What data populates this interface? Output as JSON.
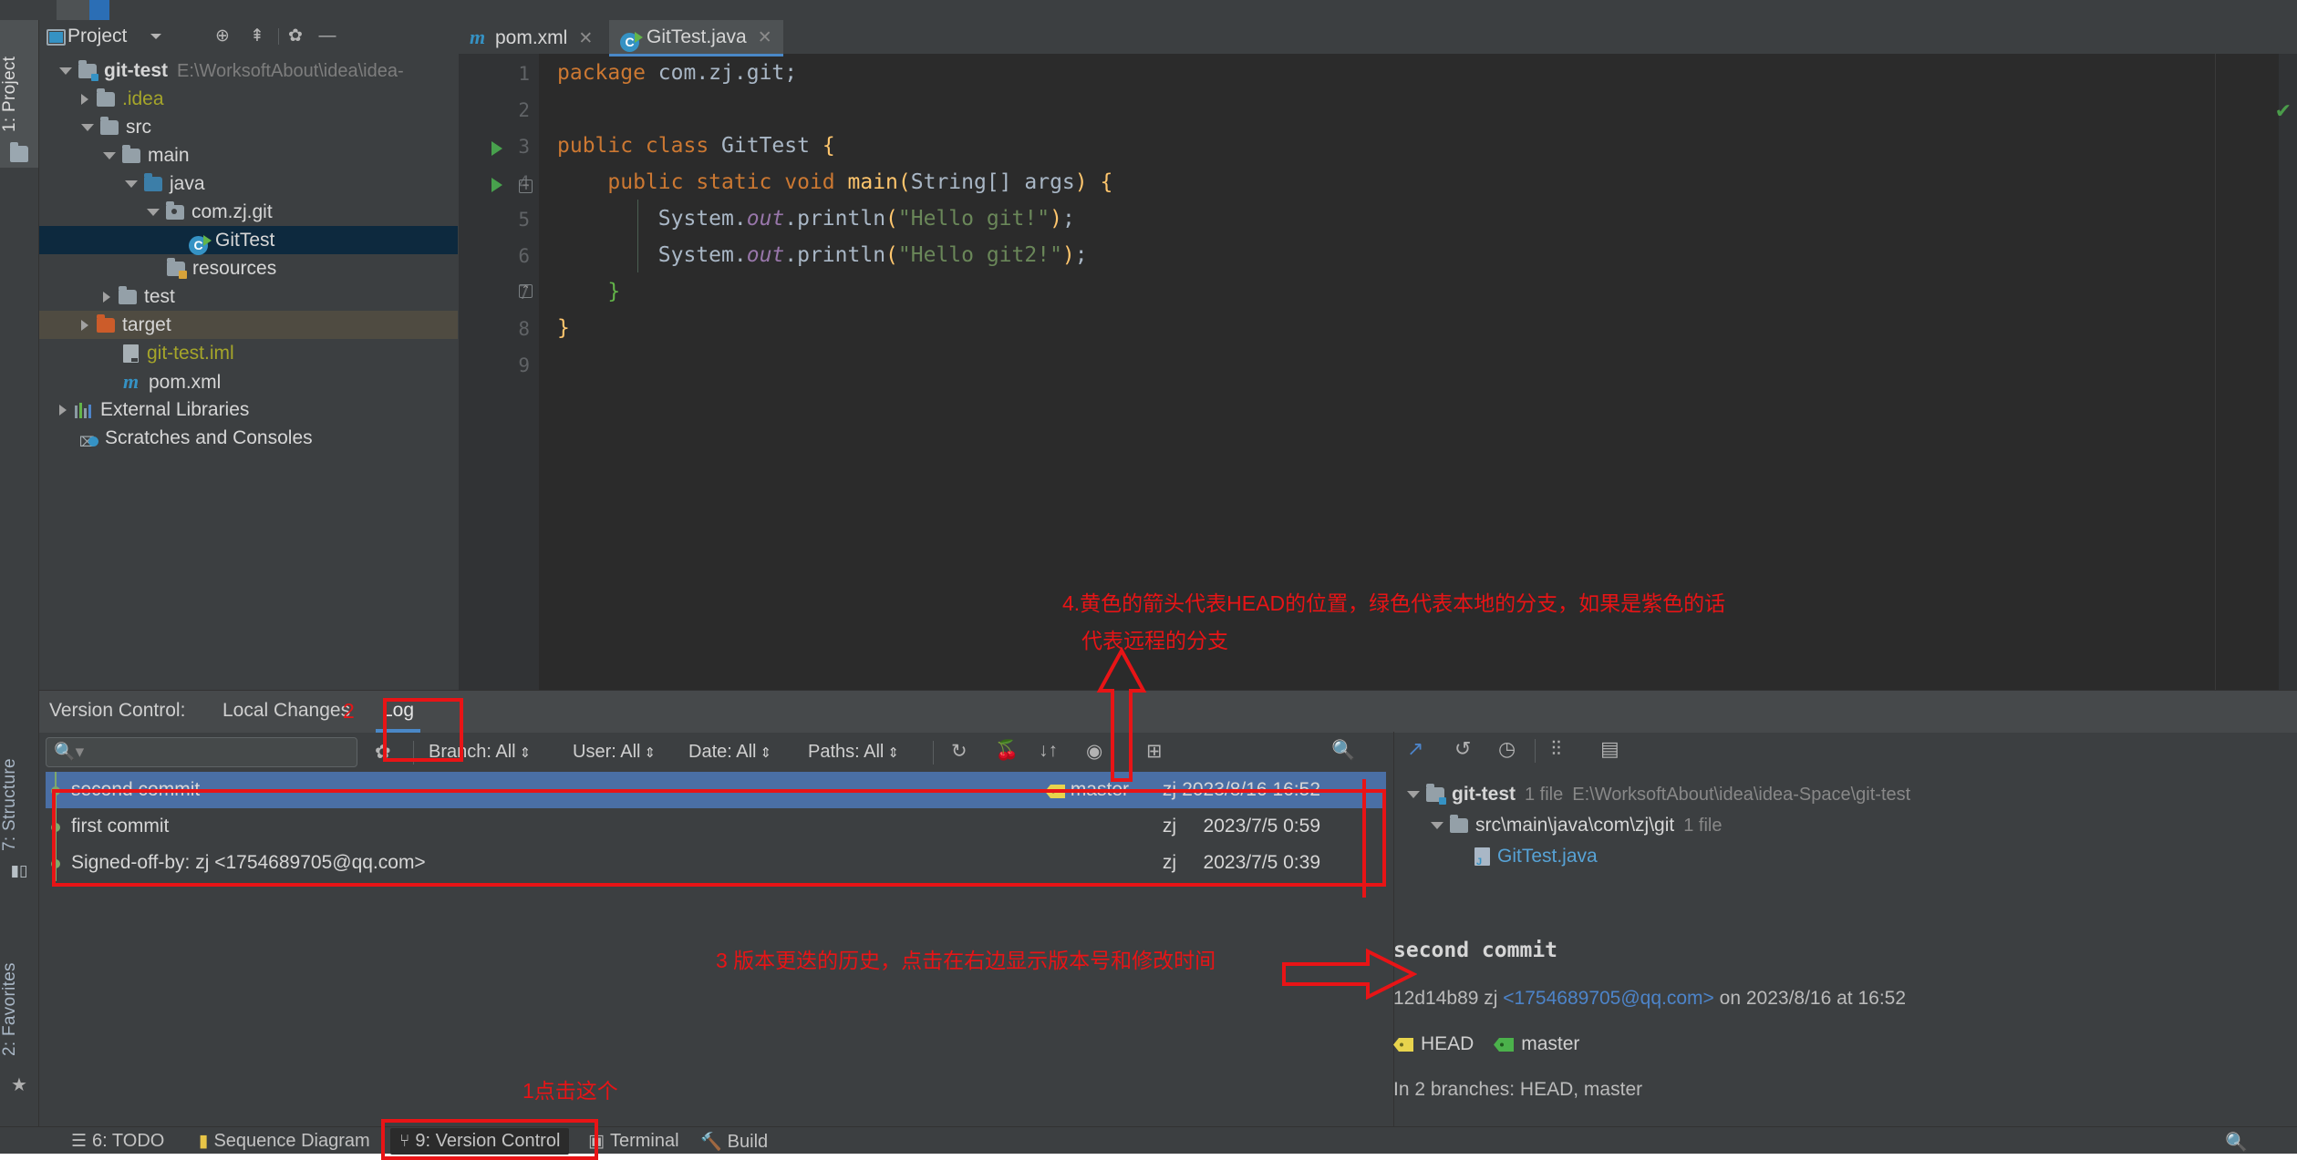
{
  "app": {
    "project_panel_title": "Project",
    "left_tabs": [
      {
        "label": "1: Project",
        "selected": true
      },
      {
        "label": "7: Structure",
        "selected": false
      },
      {
        "label": "2: Favorites",
        "selected": false
      }
    ]
  },
  "project_tree": [
    {
      "label": "git-test",
      "detail": "E:\\WorksoftAbout\\idea\\idea-",
      "indent": 0,
      "arrow": "down",
      "icon": "module-folder-icon",
      "bold": true,
      "state": "normal"
    },
    {
      "label": ".idea",
      "detail": "",
      "indent": 1,
      "arrow": "right",
      "icon": "folder-gray-icon",
      "bold": false,
      "state": "olive"
    },
    {
      "label": "src",
      "detail": "",
      "indent": 1,
      "arrow": "down",
      "icon": "folder-gray-icon",
      "bold": false,
      "state": "normal"
    },
    {
      "label": "main",
      "detail": "",
      "indent": 2,
      "arrow": "down",
      "icon": "folder-gray-icon",
      "bold": false,
      "state": "normal"
    },
    {
      "label": "java",
      "detail": "",
      "indent": 3,
      "arrow": "down",
      "icon": "folder-source-icon",
      "bold": false,
      "state": "normal"
    },
    {
      "label": "com.zj.git",
      "detail": "",
      "indent": 4,
      "arrow": "down",
      "icon": "package-icon",
      "bold": false,
      "state": "normal"
    },
    {
      "label": "GitTest",
      "detail": "",
      "indent": 5,
      "arrow": "none",
      "icon": "java-class-icon",
      "bold": false,
      "state": "selected"
    },
    {
      "label": "resources",
      "detail": "",
      "indent": 4,
      "arrow": "none",
      "icon": "folder-resources-icon",
      "bold": false,
      "state": "normal"
    },
    {
      "label": "test",
      "detail": "",
      "indent": 2,
      "arrow": "right",
      "icon": "folder-gray-icon",
      "bold": false,
      "state": "normal"
    },
    {
      "label": "target",
      "detail": "",
      "indent": 1,
      "arrow": "right",
      "icon": "folder-excluded-icon",
      "bold": false,
      "state": "highlight"
    },
    {
      "label": "git-test.iml",
      "detail": "",
      "indent": 2,
      "arrow": "none",
      "icon": "iml-file-icon",
      "bold": false,
      "state": "olive"
    },
    {
      "label": "pom.xml",
      "detail": "",
      "indent": 2,
      "arrow": "none",
      "icon": "maven-file-icon",
      "bold": false,
      "state": "normal"
    },
    {
      "label": "External Libraries",
      "detail": "",
      "indent": 0,
      "arrow": "right",
      "icon": "libraries-icon",
      "bold": false,
      "state": "normal"
    },
    {
      "label": "Scratches and Consoles",
      "detail": "",
      "indent": 0,
      "arrow": "none",
      "icon": "scratches-icon",
      "bold": false,
      "state": "normal"
    }
  ],
  "editor": {
    "tabs": [
      {
        "label": "pom.xml",
        "icon": "maven-icon",
        "active": false
      },
      {
        "label": "GitTest.java",
        "icon": "java-class-icon",
        "active": true
      }
    ],
    "line_numbers": [
      "1",
      "2",
      "3",
      "4",
      "5",
      "6",
      "7",
      "8",
      "9"
    ],
    "code_lines": [
      {
        "n": 1,
        "text": "package com.zj.git;"
      },
      {
        "n": 2,
        "text": ""
      },
      {
        "n": 3,
        "text": "public class GitTest {"
      },
      {
        "n": 4,
        "text": "    public static void main(String[] args) {"
      },
      {
        "n": 5,
        "text": "        System.out.println(\"Hello git!\");"
      },
      {
        "n": 6,
        "text": "        System.out.println(\"Hello git2!\");"
      },
      {
        "n": 7,
        "text": "    }"
      },
      {
        "n": 8,
        "text": "}"
      },
      {
        "n": 9,
        "text": ""
      }
    ]
  },
  "version_control": {
    "panel_label": "Version Control:",
    "tabs": [
      {
        "label": "Local Changes",
        "selected": false
      },
      {
        "label": "Log",
        "selected": true
      }
    ],
    "annotation_number": "2",
    "search_placeholder": "",
    "search_icon": "search-icon",
    "filters": [
      {
        "label": "Branch: All"
      },
      {
        "label": "User: All"
      },
      {
        "label": "Date: All"
      },
      {
        "label": "Paths: All"
      }
    ],
    "toolbar_icons": [
      "refresh-icon",
      "cherry-pick-icon",
      "sort-icon",
      "eye-icon",
      "show-details-icon"
    ],
    "search_magnifier": "search-icon",
    "commits": [
      {
        "message": "second commit",
        "tag": "master",
        "tag_color": "#e8d44d",
        "author": "zj",
        "date": "2023/8/16 16:52",
        "selected": true
      },
      {
        "message": "first commit",
        "tag": "",
        "tag_color": "",
        "author": "zj",
        "date": "2023/7/5 0:59",
        "selected": false
      },
      {
        "message": "Signed-off-by: zj <1754689705@qq.com>",
        "tag": "",
        "tag_color": "",
        "author": "zj",
        "date": "2023/7/5 0:39",
        "selected": false
      }
    ],
    "right_toolbar_icons": [
      "jump-to-source-icon",
      "revert-icon",
      "history-icon",
      "group-by-icon",
      "expand-icon"
    ],
    "changed_files": [
      {
        "label": "git-test",
        "count": "1 file",
        "path": "E:\\WorksoftAbout\\idea\\idea-Space\\git-test",
        "indent": 0,
        "arrow": "down",
        "icon": "module-folder-icon",
        "bold": true,
        "link": false
      },
      {
        "label": "src\\main\\java\\com\\zj\\git",
        "count": "1 file",
        "path": "",
        "indent": 1,
        "arrow": "down",
        "icon": "folder-gray-icon",
        "bold": false,
        "link": false
      },
      {
        "label": "GitTest.java",
        "count": "",
        "path": "",
        "indent": 2,
        "arrow": "none",
        "icon": "java-file-icon",
        "bold": false,
        "link": true
      }
    ],
    "commit_detail": {
      "title": "second commit",
      "hash": "12d14b89",
      "author": "zj",
      "email": "<1754689705@qq.com>",
      "on_text": "on 2023/8/16 at 16:52",
      "refs": [
        {
          "label": "HEAD",
          "color": "#e8d44d"
        },
        {
          "label": "master",
          "color": "#4bb14b"
        }
      ],
      "branches_text": "In 2 branches: HEAD, master"
    }
  },
  "status_bar": [
    {
      "label": "6: TODO",
      "icon": "todo-icon",
      "underline_index": 0,
      "selected": false
    },
    {
      "label": "Sequence Diagram",
      "icon": "sequence-diagram-icon",
      "underline_index": -1,
      "selected": false
    },
    {
      "label": "9: Version Control",
      "icon": "version-control-icon",
      "underline_index": 0,
      "selected": true
    },
    {
      "label": "Terminal",
      "icon": "terminal-icon",
      "underline_index": -1,
      "selected": false
    },
    {
      "label": "Build",
      "icon": "build-icon",
      "underline_index": -1,
      "selected": false
    }
  ],
  "annotations": [
    {
      "id": "ann-4",
      "line1": "4.黄色的箭头代表HEAD的位置，绿色代表本地的分支，如果是紫色的话",
      "line2": "代表远程的分支"
    },
    {
      "id": "ann-3",
      "text": "3 版本更迭的历史，点击在右边显示版本号和修改时间"
    },
    {
      "id": "ann-1",
      "text": "1点击这个"
    },
    {
      "id": "ann-2",
      "text": "2"
    }
  ],
  "colors": {
    "accent": "#4a88c7",
    "annotation_red": "#e81416",
    "selection_blue": "#4a6fa5",
    "tree_selection": "#0d293e",
    "panel_bg": "#3c3f41",
    "editor_bg": "#2b2b2b"
  }
}
